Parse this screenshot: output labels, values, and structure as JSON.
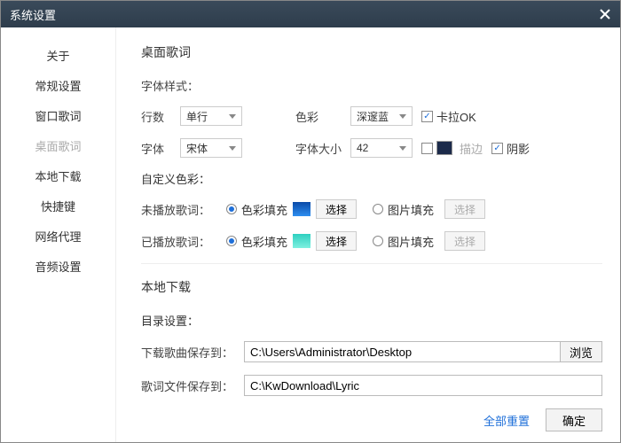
{
  "title": "系统设置",
  "sidebar": {
    "items": [
      {
        "label": "关于"
      },
      {
        "label": "常规设置"
      },
      {
        "label": "窗口歌词"
      },
      {
        "label": "桌面歌词"
      },
      {
        "label": "本地下载"
      },
      {
        "label": "快捷键"
      },
      {
        "label": "网络代理"
      },
      {
        "label": "音频设置"
      }
    ],
    "activeIndex": 3
  },
  "desktop_lyrics": {
    "heading": "桌面歌词",
    "font_style_label": "字体样式：",
    "rows_label": "行数",
    "rows_value": "单行",
    "color_label": "色彩",
    "color_value": "深邃蓝",
    "karaoke_label": "卡拉OK",
    "karaoke_checked": true,
    "font_label": "字体",
    "font_value": "宋体",
    "font_size_label": "字体大小",
    "font_size_value": "42",
    "stroke_label": "描边",
    "stroke_checked": false,
    "stroke_color": "#1c2a4a",
    "shadow_label": "阴影",
    "shadow_checked": true,
    "custom_color_label": "自定义色彩：",
    "unplayed_label": "未播放歌词：",
    "played_label": "已播放歌词：",
    "color_fill_label": "色彩填充",
    "image_fill_label": "图片填充",
    "select_btn": "选择"
  },
  "download": {
    "heading": "本地下载",
    "dir_label": "目录设置：",
    "song_path_label": "下载歌曲保存到：",
    "song_path_value": "C:\\Users\\Administrator\\Desktop",
    "browse_label": "浏览",
    "lyric_path_label": "歌词文件保存到：",
    "lyric_path_value": "C:\\KwDownload\\Lyric"
  },
  "footer": {
    "reset": "全部重置",
    "ok": "确定"
  }
}
